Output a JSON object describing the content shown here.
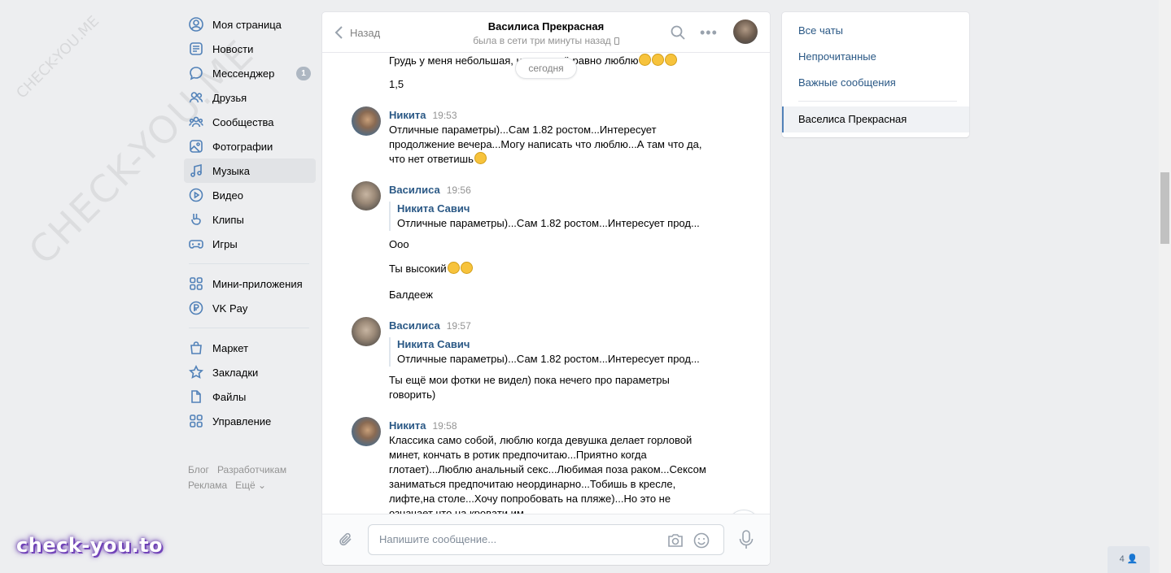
{
  "watermark": {
    "diagonal": "CHECK-YOU.ME",
    "small": "CHECK-YOU.ME",
    "logo": "check-you.to"
  },
  "nav": {
    "items": [
      {
        "label": "Моя страница",
        "icon": "user-circle-icon"
      },
      {
        "label": "Новости",
        "icon": "news-icon"
      },
      {
        "label": "Мессенджер",
        "icon": "messenger-icon",
        "badge": "1"
      },
      {
        "label": "Друзья",
        "icon": "friends-icon"
      },
      {
        "label": "Сообщества",
        "icon": "communities-icon"
      },
      {
        "label": "Фотографии",
        "icon": "photo-icon"
      },
      {
        "label": "Музыка",
        "icon": "music-icon",
        "active": true
      },
      {
        "label": "Видео",
        "icon": "video-icon"
      },
      {
        "label": "Клипы",
        "icon": "clips-icon"
      },
      {
        "label": "Игры",
        "icon": "gamepad-icon"
      }
    ],
    "items2": [
      {
        "label": "Мини-приложения",
        "icon": "apps-icon"
      },
      {
        "label": "VK Pay",
        "icon": "vkpay-icon"
      }
    ],
    "items3": [
      {
        "label": "Маркет",
        "icon": "market-icon"
      },
      {
        "label": "Закладки",
        "icon": "star-icon"
      },
      {
        "label": "Файлы",
        "icon": "file-icon"
      },
      {
        "label": "Управление",
        "icon": "manage-icon"
      }
    ],
    "footer": {
      "blog": "Блог",
      "dev": "Разработчикам",
      "ads": "Реклама",
      "more": "Ещё ⌄"
    }
  },
  "chat": {
    "back_label": "Назад",
    "title": "Василиса Прекрасная",
    "status": "была в сети три минуты назад",
    "date_pill": "сегодня",
    "messages": {
      "m0_text": "Грудь у меня небольшая, но мне всё равно люблю",
      "m0_extra": "1,5",
      "m1_author": "Никита",
      "m1_time": "19:53",
      "m1_text": "Отличные параметры)...Сам 1.82 ростом...Интересует продолжение вечера...Могу написать что люблю...А там что да, что нет ответишь",
      "m2_author": "Василиса",
      "m2_time": "19:56",
      "m2_quote_author": "Никита Савич",
      "m2_quote_text": "Отличные параметры)...Сам 1.82 ростом...Интересует прод...",
      "m2_l1": "Ооо",
      "m2_l2": "Ты высокий",
      "m2_l3": "Балдееж",
      "m3_author": "Василиса",
      "m3_time": "19:57",
      "m3_quote_author": "Никита Савич",
      "m3_quote_text": "Отличные параметры)...Сам 1.82 ростом...Интересует прод...",
      "m3_text": "Ты ещё мои фотки не видел) пока нечего про параметры говорить)",
      "m4_author": "Никита",
      "m4_time": "19:58",
      "m4_text": "Классика само собой, люблю когда девушка делает горловой минет, кончать в ротик предпочитаю...Приятно когда глотает)...Люблю анальный секс...Любимая поза раком...Сексом заниматься предпочитаю неординарно...Тобишь в кресле, лифте,на столе...Хочу попробовать на пляже)...Но это не означает что на кровати им"
    },
    "composer_placeholder": "Напишите сообщение..."
  },
  "right": {
    "all_chats": "Все чаты",
    "unread": "Непрочитанные",
    "important": "Важные сообщения",
    "active_chat": "Васелиса Прекрасная"
  },
  "online_count": "4 👤",
  "colors": {
    "link": "#2a5885",
    "accent": "#5181b8",
    "bg": "#edeef0"
  }
}
